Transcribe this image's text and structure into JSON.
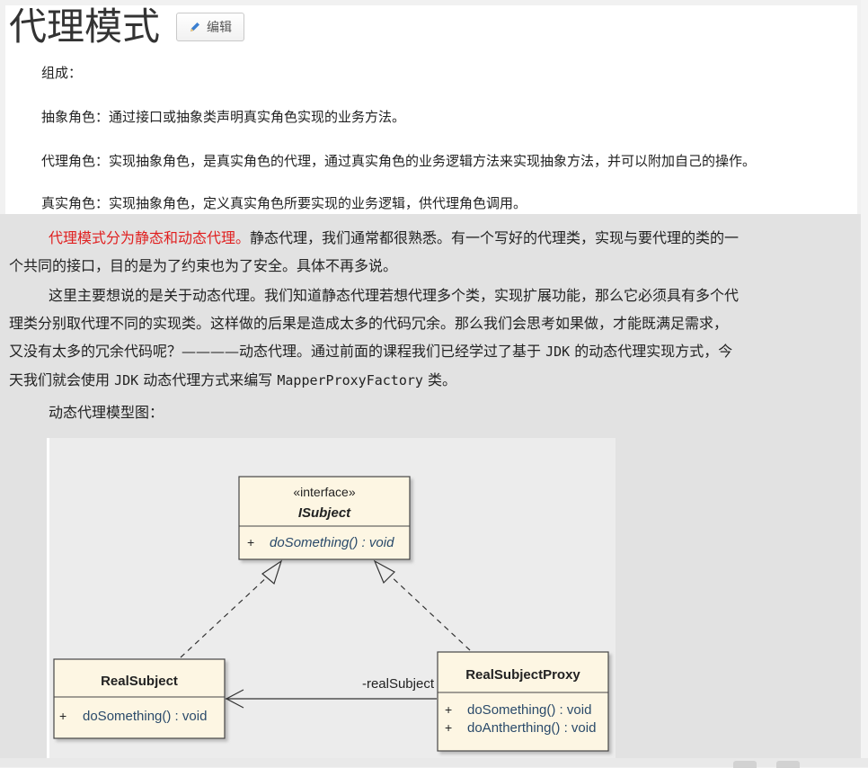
{
  "header": {
    "title": "代理模式",
    "edit_label": "编辑"
  },
  "definitions": {
    "intro": "组成：",
    "abstract_role": "抽象角色：通过接口或抽象类声明真实角色实现的业务方法。",
    "proxy_role": "代理角色：实现抽象角色，是真实角色的代理，通过真实角色的业务逻辑方法来实现抽象方法，并可以附加自己的操作。",
    "real_role": "真实角色：实现抽象角色，定义真实角色所要实现的业务逻辑，供代理角色调用。"
  },
  "article": {
    "p1_highlight": "代理模式分为静态和动态代理。",
    "p1_line1_rest": "静态代理，我们通常都很熟悉。有一个写好的代理类，实现与要代理的类的一",
    "p1_line2": "个共同的接口，目的是为了约束也为了安全。具体不再多说。",
    "p2_line1": "这里主要想说的是关于动态代理。我们知道静态代理若想代理多个类，实现扩展功能，那么它必须具有多个代",
    "p2_line2": "理类分别取代理不同的实现类。这样做的后果是造成太多的代码冗余。那么我们会思考如果做，才能既满足需求，",
    "p2_line3_a": "又没有太多的冗余代码呢？————动态代理。通过前面的课程我们已经学过了基于 ",
    "p2_line3_code": "JDK",
    "p2_line3_b": " 的动态代理实现方式，今",
    "p2_line4_a": "天我们就会使用 ",
    "p2_line4_code1": "JDK",
    "p2_line4_b": " 动态代理方式来编写 ",
    "p2_line4_code2": "MapperProxyFactory",
    "p2_line4_c": " 类。",
    "p3": "动态代理模型图："
  },
  "diagram": {
    "interface_box": {
      "stereotype": "«interface»",
      "name": "ISubject",
      "op_visibility": "+",
      "operation": "doSomething() : void"
    },
    "real_subject": {
      "name": "RealSubject",
      "op_visibility": "+",
      "operation": "doSomething() : void"
    },
    "proxy": {
      "name": "RealSubjectProxy",
      "op1_visibility": "+",
      "op1": "doSomething() : void",
      "op2_visibility": "+",
      "op2": "doAntherthing() : void"
    },
    "association_label": "-realSubject",
    "colors": {
      "box_fill": "#fdf6e3",
      "box_border": "#444444",
      "operation_text": "#2a4a6a"
    }
  }
}
